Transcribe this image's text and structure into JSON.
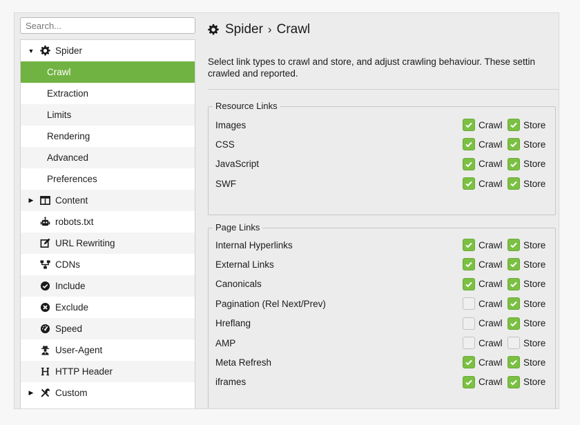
{
  "search": {
    "placeholder": "Search..."
  },
  "sidebar": {
    "items": [
      {
        "label": "Spider",
        "icon": "gear-icon",
        "expanded": true
      },
      {
        "label": "Crawl",
        "selected": true
      },
      {
        "label": "Extraction"
      },
      {
        "label": "Limits"
      },
      {
        "label": "Rendering"
      },
      {
        "label": "Advanced"
      },
      {
        "label": "Preferences"
      },
      {
        "label": "Content",
        "icon": "columns-icon",
        "expanded": false
      },
      {
        "label": "robots.txt",
        "icon": "robot-icon"
      },
      {
        "label": "URL Rewriting",
        "icon": "edit-icon"
      },
      {
        "label": "CDNs",
        "icon": "network-icon"
      },
      {
        "label": "Include",
        "icon": "check-circle-icon"
      },
      {
        "label": "Exclude",
        "icon": "x-circle-icon"
      },
      {
        "label": "Speed",
        "icon": "speedometer-icon"
      },
      {
        "label": "User-Agent",
        "icon": "user-secret-icon"
      },
      {
        "label": "HTTP Header",
        "icon": "header-h-icon"
      },
      {
        "label": "Custom",
        "icon": "tools-icon",
        "expanded": false
      }
    ]
  },
  "header": {
    "title": "Spider",
    "separator": "›",
    "subtitle": "Crawl"
  },
  "description": {
    "line1": "Select link types to crawl and store, and adjust crawling behaviour. These settin",
    "line2": "crawled and reported."
  },
  "labels": {
    "crawl": "Crawl",
    "store": "Store"
  },
  "colors": {
    "accent": "#71b342",
    "checkbox_on": "#7bc043"
  },
  "resource_links": {
    "title": "Resource Links",
    "rows": [
      {
        "name": "Images",
        "crawl": true,
        "store": true
      },
      {
        "name": "CSS",
        "crawl": true,
        "store": true
      },
      {
        "name": "JavaScript",
        "crawl": true,
        "store": true
      },
      {
        "name": "SWF",
        "crawl": true,
        "store": true
      }
    ]
  },
  "page_links": {
    "title": "Page Links",
    "rows": [
      {
        "name": "Internal Hyperlinks",
        "crawl": true,
        "store": true
      },
      {
        "name": "External Links",
        "crawl": true,
        "store": true
      },
      {
        "name": "Canonicals",
        "crawl": true,
        "store": true
      },
      {
        "name": "Pagination (Rel Next/Prev)",
        "crawl": false,
        "store": true
      },
      {
        "name": "Hreflang",
        "crawl": false,
        "store": true
      },
      {
        "name": "AMP",
        "crawl": false,
        "store": false
      },
      {
        "name": "Meta Refresh",
        "crawl": true,
        "store": true
      },
      {
        "name": "iframes",
        "crawl": true,
        "store": true
      }
    ]
  }
}
